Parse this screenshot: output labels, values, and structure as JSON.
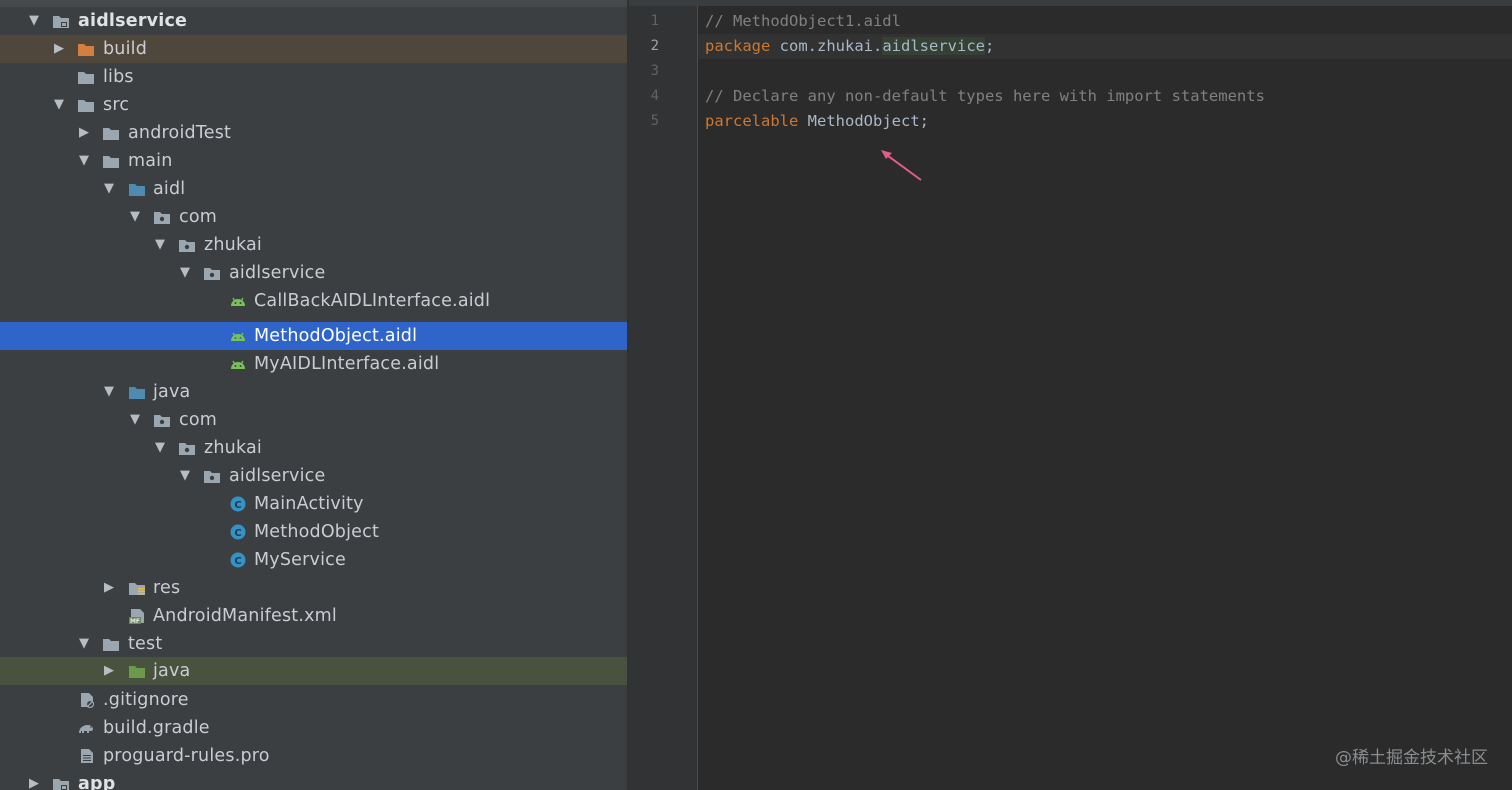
{
  "tree": {
    "rows": [
      {
        "label": "aidlservice",
        "bold": true
      },
      {
        "label": "build"
      },
      {
        "label": "libs"
      },
      {
        "label": "src"
      },
      {
        "label": "androidTest"
      },
      {
        "label": "main"
      },
      {
        "label": "aidl"
      },
      {
        "label": "com"
      },
      {
        "label": "zhukai"
      },
      {
        "label": "aidlservice"
      },
      {
        "label": "CallBackAIDLInterface.aidl"
      },
      {
        "label": "MethodObject.aidl",
        "selected": true
      },
      {
        "label": "MyAIDLInterface.aidl"
      },
      {
        "label": "java"
      },
      {
        "label": "com"
      },
      {
        "label": "zhukai"
      },
      {
        "label": "aidlservice"
      },
      {
        "label": "MainActivity"
      },
      {
        "label": "MethodObject"
      },
      {
        "label": "MyService"
      },
      {
        "label": "res"
      },
      {
        "label": "AndroidManifest.xml"
      },
      {
        "label": "test"
      },
      {
        "label": "java"
      },
      {
        "label": ".gitignore"
      },
      {
        "label": "build.gradle"
      },
      {
        "label": "proguard-rules.pro"
      },
      {
        "label": "app",
        "bold": true
      }
    ]
  },
  "editor": {
    "line_numbers": [
      "1",
      "2",
      "3",
      "4",
      "5"
    ],
    "lines": {
      "l1": "// MethodObject1.aidl",
      "l2_kw": "package",
      "l2_pkg": "com.zhukai.",
      "l2_pkg_hl": "aidlservice",
      "l2_semi": ";",
      "l4": "// Declare any non-default types here with import statements",
      "l5_kw": "parcelable",
      "l5_rest": "MethodObject;"
    }
  },
  "watermark": "@稀土掘金技术社区",
  "colors": {
    "selection": "#2f65ca",
    "keyword": "#cc7832",
    "comment": "#808080",
    "android_green": "#78c257",
    "class_icon": "#3592c4",
    "arrow_annotation": "#e05c8a"
  }
}
